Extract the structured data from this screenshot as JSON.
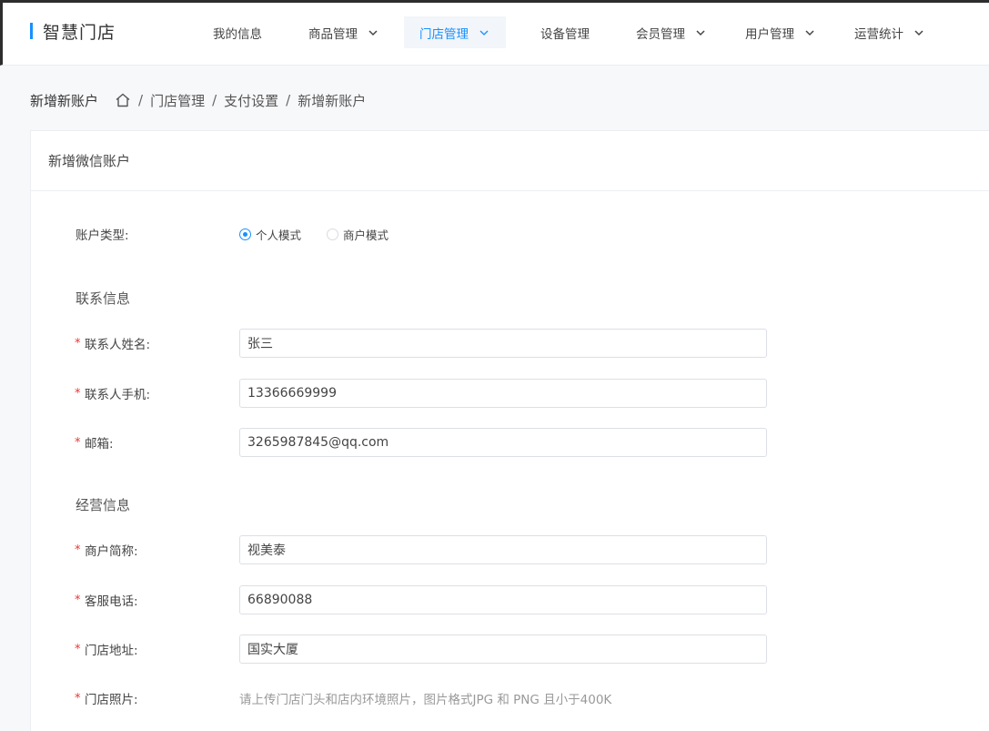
{
  "brand": {
    "name": "智慧门店",
    "accent": "#1890ff"
  },
  "nav": [
    {
      "label": "我的信息",
      "has_dropdown": false,
      "active": false
    },
    {
      "label": "商品管理",
      "has_dropdown": true,
      "active": false
    },
    {
      "label": "门店管理",
      "has_dropdown": true,
      "active": true
    },
    {
      "label": "设备管理",
      "has_dropdown": false,
      "active": false
    },
    {
      "label": "会员管理",
      "has_dropdown": true,
      "active": false
    },
    {
      "label": "用户管理",
      "has_dropdown": true,
      "active": false
    },
    {
      "label": "运营统计",
      "has_dropdown": true,
      "active": false
    }
  ],
  "breadcrumb": {
    "title": "新增新账户",
    "items": [
      "门店管理",
      "支付设置",
      "新增新账户"
    ],
    "separator": "/"
  },
  "card": {
    "title": "新增微信账户"
  },
  "form": {
    "account_type": {
      "label": "账户类型:",
      "options": [
        "个人模式",
        "商户模式"
      ],
      "selected": "个人模式"
    },
    "contact_section": "联系信息",
    "contact_name": {
      "label": "联系人姓名:",
      "value": "张三"
    },
    "contact_phone": {
      "label": "联系人手机:",
      "value": "13366669999"
    },
    "email": {
      "label": "邮箱:",
      "value": "3265987845@qq.com"
    },
    "business_section": "经营信息",
    "merchant_short": {
      "label": "商户简称:",
      "value": "视美泰"
    },
    "service_phone": {
      "label": "客服电话:",
      "value": "66890088"
    },
    "store_address": {
      "label": "门店地址:",
      "value": "国实大厦"
    },
    "store_photo": {
      "label": "门店照片:",
      "hint": "请上传门店门头和店内环境照片，图片格式JPG 和 PNG 且小于400K"
    },
    "required_mark": "*"
  }
}
